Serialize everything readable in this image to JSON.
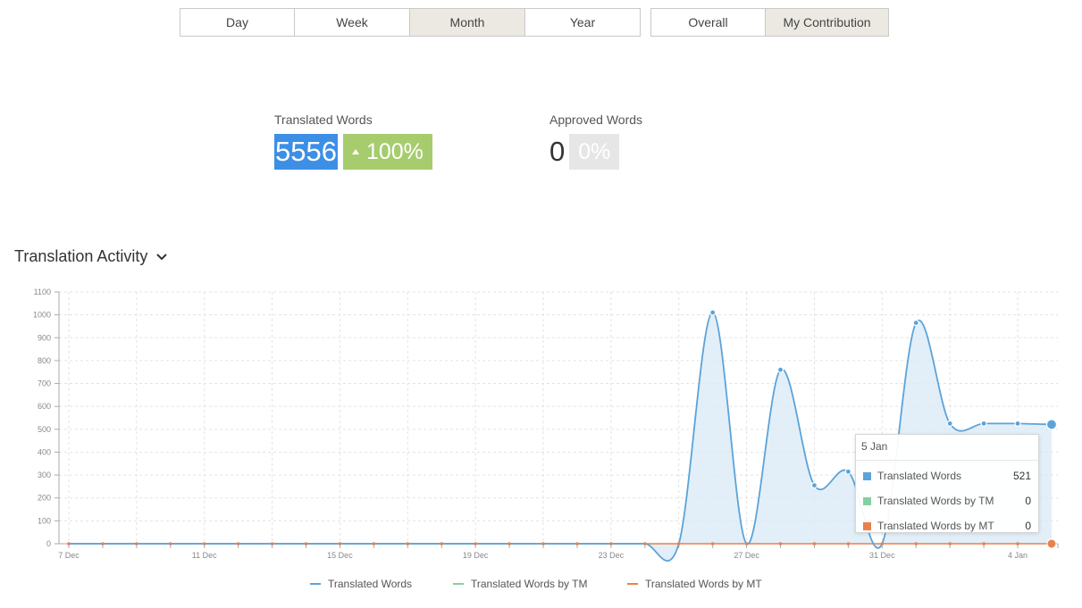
{
  "period_buttons": [
    {
      "label": "Day",
      "active": false
    },
    {
      "label": "Week",
      "active": false
    },
    {
      "label": "Month",
      "active": true
    },
    {
      "label": "Year",
      "active": false
    }
  ],
  "scope_buttons": [
    {
      "label": "Overall",
      "active": false
    },
    {
      "label": "My Contribution",
      "active": true
    }
  ],
  "stats": {
    "translated": {
      "label": "Translated Words",
      "value": "5556",
      "change": "100%"
    },
    "approved": {
      "label": "Approved Words",
      "value": "0",
      "change": "0%"
    }
  },
  "section_title": "Translation Activity",
  "colors": {
    "translated": "#5ba3d9",
    "tm": "#86cfa0",
    "mt": "#e8814d",
    "area_fill": "#d8eaf6"
  },
  "chart_data": {
    "type": "area",
    "x": [
      "7 Dec",
      "8 Dec",
      "9 Dec",
      "10 Dec",
      "11 Dec",
      "12 Dec",
      "13 Dec",
      "14 Dec",
      "15 Dec",
      "16 Dec",
      "17 Dec",
      "18 Dec",
      "19 Dec",
      "20 Dec",
      "21 Dec",
      "22 Dec",
      "23 Dec",
      "24 Dec",
      "25 Dec",
      "26 Dec",
      "27 Dec",
      "28 Dec",
      "29 Dec",
      "30 Dec",
      "31 Dec",
      "1 Jan",
      "2 Jan",
      "3 Jan",
      "4 Jan",
      "5 Jan"
    ],
    "x_tick_labels": [
      "7 Dec",
      "11 Dec",
      "15 Dec",
      "19 Dec",
      "23 Dec",
      "27 Dec",
      "31 Dec",
      "4 Jan"
    ],
    "y_ticks": [
      0,
      100,
      200,
      300,
      400,
      500,
      600,
      700,
      800,
      900,
      1000,
      1100
    ],
    "ylim": [
      0,
      1100
    ],
    "grid": true,
    "series": [
      {
        "name": "Translated Words",
        "values": [
          0,
          0,
          0,
          0,
          0,
          0,
          0,
          0,
          0,
          0,
          0,
          0,
          0,
          0,
          0,
          0,
          0,
          0,
          0,
          1010,
          0,
          760,
          255,
          315,
          0,
          965,
          525,
          525,
          525,
          521
        ]
      },
      {
        "name": "Translated Words by TM",
        "values": [
          0,
          0,
          0,
          0,
          0,
          0,
          0,
          0,
          0,
          0,
          0,
          0,
          0,
          0,
          0,
          0,
          0,
          0,
          0,
          0,
          0,
          0,
          0,
          0,
          0,
          0,
          0,
          0,
          0,
          0
        ]
      },
      {
        "name": "Translated Words by MT",
        "values": [
          0,
          0,
          0,
          0,
          0,
          0,
          0,
          0,
          0,
          0,
          0,
          0,
          0,
          0,
          0,
          0,
          0,
          0,
          0,
          0,
          0,
          0,
          0,
          0,
          0,
          0,
          0,
          0,
          0,
          0
        ]
      }
    ],
    "legend_position": "bottom"
  },
  "tooltip": {
    "title": "5 Jan",
    "rows": [
      {
        "label": "Translated Words",
        "value": "521"
      },
      {
        "label": "Translated Words by TM",
        "value": "0"
      },
      {
        "label": "Translated Words by MT",
        "value": "0"
      }
    ]
  }
}
